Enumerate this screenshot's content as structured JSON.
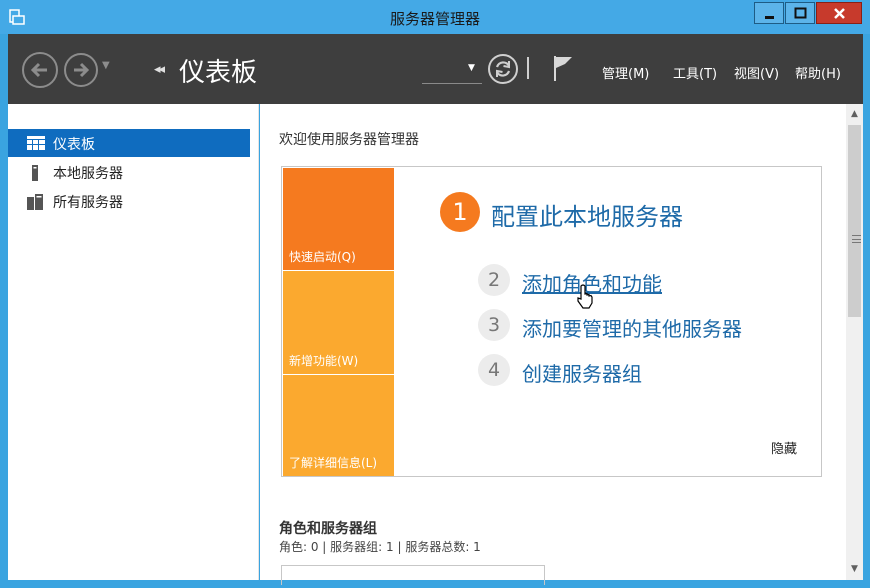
{
  "window": {
    "title": "服务器管理器"
  },
  "header": {
    "breadcrumb_arrows": "◂◂",
    "breadcrumb_title": "仪表板",
    "menu": {
      "manage": "管理(M)",
      "tools": "工具(T)",
      "view": "视图(V)",
      "help": "帮助(H)"
    }
  },
  "sidebar": {
    "items": [
      {
        "label": "仪表板",
        "icon": "dashboard-icon",
        "active": true
      },
      {
        "label": "本地服务器",
        "icon": "local-server-icon",
        "active": false
      },
      {
        "label": "所有服务器",
        "icon": "all-servers-icon",
        "active": false
      }
    ]
  },
  "main": {
    "welcome": "欢迎使用服务器管理器",
    "tiles": {
      "quick_start": "快速启动(Q)",
      "whats_new": "新增功能(W)",
      "learn_more": "了解详细信息(L)"
    },
    "steps": [
      {
        "num": "1",
        "label": "配置此本地服务器"
      },
      {
        "num": "2",
        "label": "添加角色和功能"
      },
      {
        "num": "3",
        "label": "添加要管理的其他服务器"
      },
      {
        "num": "4",
        "label": "创建服务器组"
      }
    ],
    "hide_label": "隐藏",
    "roles_title": "角色和服务器组",
    "roles_summary": "角色: 0 | 服务器组: 1 | 服务器总数: 1"
  },
  "colors": {
    "accent": "#0f6cbf",
    "tile_orange": "#f57a1f",
    "tile_amber": "#fba92f",
    "link_blue": "#1e6aa8",
    "header_bg": "#3e3e3e",
    "window_blue": "#44a9e6"
  }
}
